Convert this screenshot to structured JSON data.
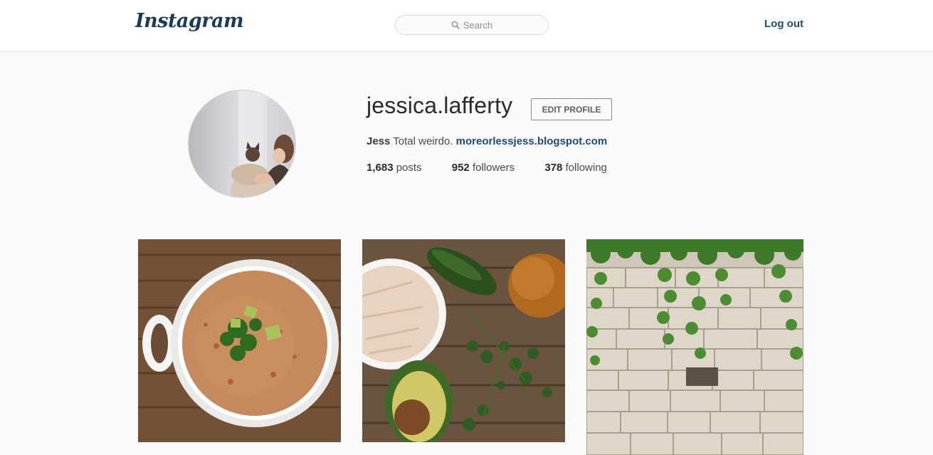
{
  "header": {
    "logo": "Instagram",
    "search_placeholder": "Search",
    "logout_label": "Log out"
  },
  "profile": {
    "username": "jessica.lafferty",
    "edit_label": "EDIT PROFILE",
    "bio_name": "Jess",
    "bio_text": "Total weirdo.",
    "bio_link": "moreorlessjess.blogspot.com",
    "stats": {
      "posts_count": "1,683",
      "posts_label": "posts",
      "followers_count": "952",
      "followers_label": "followers",
      "following_count": "378",
      "following_label": "following"
    }
  },
  "colors": {
    "brand": "#1b3a57",
    "link": "#1e4d74",
    "background": "#fafafa"
  },
  "icons": {
    "search": "search-icon"
  },
  "posts": [
    {
      "subject": "soup-bowl-photo"
    },
    {
      "subject": "vegetables-photo"
    },
    {
      "subject": "stone-wall-ivy-photo"
    }
  ]
}
